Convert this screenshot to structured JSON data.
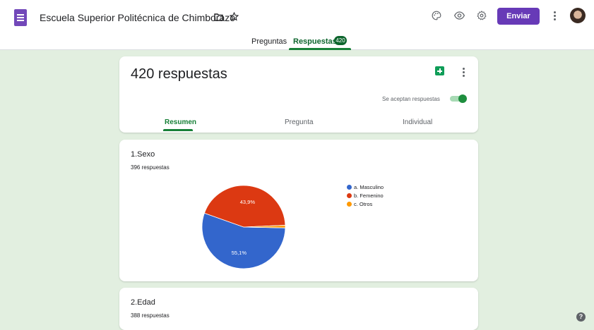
{
  "header": {
    "title": "Escuela Superior Politécnica de Chimborazo",
    "send_label": "Enviar"
  },
  "icons": {
    "app": "forms-icon",
    "folder": "folder-icon",
    "star": "star-icon",
    "palette": "palette-icon",
    "preview": "eye-icon",
    "settings": "gear-icon",
    "more": "more-vert-icon",
    "sheets": "sheets-icon",
    "help": "help-icon"
  },
  "tabs": {
    "questions": "Preguntas",
    "responses": "Respuestas",
    "responses_badge": "420"
  },
  "summary": {
    "count_label": "420 respuestas",
    "accepting_label": "Se aceptan respuestas",
    "accepting": true,
    "subtabs": [
      "Resumen",
      "Pregunta",
      "Individual"
    ],
    "active_subtab": "Resumen"
  },
  "questions": [
    {
      "title": "1.Sexo",
      "count": "396 respuestas",
      "chart_data": {
        "type": "pie",
        "categories": [
          "a. Masculino",
          "b. Femenino",
          "c. Otros"
        ],
        "values": [
          55.1,
          43.9,
          1.0
        ],
        "labels": [
          "55,1%",
          "43,9%",
          ""
        ],
        "colors": [
          "#3366cc",
          "#dc3912",
          "#ff9900"
        ],
        "legend": "right"
      }
    },
    {
      "title": "2.Edad",
      "count": "388 respuestas"
    }
  ],
  "help": "?",
  "colors": {
    "accent": "#188038",
    "send": "#673ab7",
    "background": "#e2efe0"
  }
}
